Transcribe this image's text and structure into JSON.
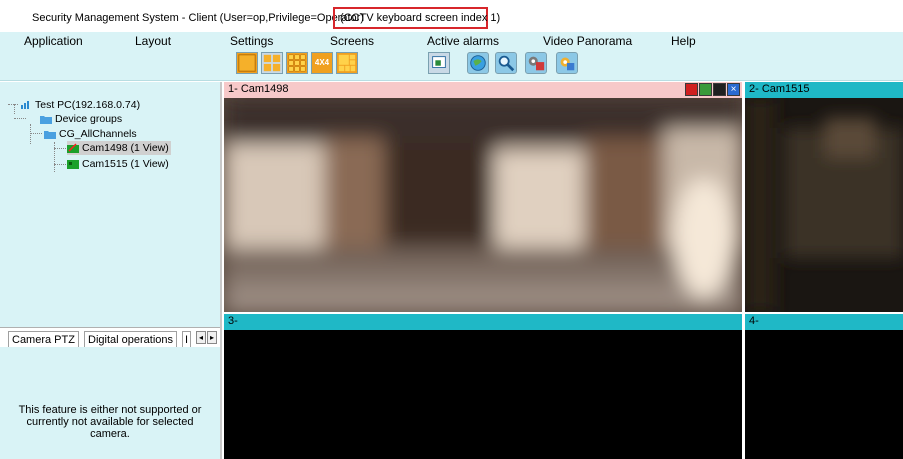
{
  "window": {
    "title": "Security Management System - Client (User=op,Privilege=Operator)",
    "highlight": "(CCTV keyboard screen index 1)"
  },
  "menu": [
    "Application",
    "Layout",
    "Settings",
    "Screens",
    "Active alarms",
    "Video Panorama",
    "Help"
  ],
  "toolbar": {
    "layout_4x4_label": "4X4"
  },
  "tree": {
    "root": "Test PC(192.168.0.74)",
    "device_groups": "Device groups",
    "group": "CG_AllChannels",
    "cameras": [
      "Cam1498 (1 View)",
      "Cam1515 (1 View)"
    ]
  },
  "tabs": {
    "camera_ptz": "Camera PTZ",
    "digital_operations": "Digital operations",
    "truncated": "I"
  },
  "ptz_message": "This feature is either not supported or currently not available for selected camera.",
  "views": [
    {
      "label": "1- Cam1498"
    },
    {
      "label": "2- Cam1515"
    },
    {
      "label": "3-"
    },
    {
      "label": "4-"
    }
  ],
  "colors": {
    "panel_bg": "#d9f3f6",
    "active_view_header": "#f7c9c9",
    "view_header": "#1fb8c6",
    "highlight_border": "#d7262b"
  }
}
